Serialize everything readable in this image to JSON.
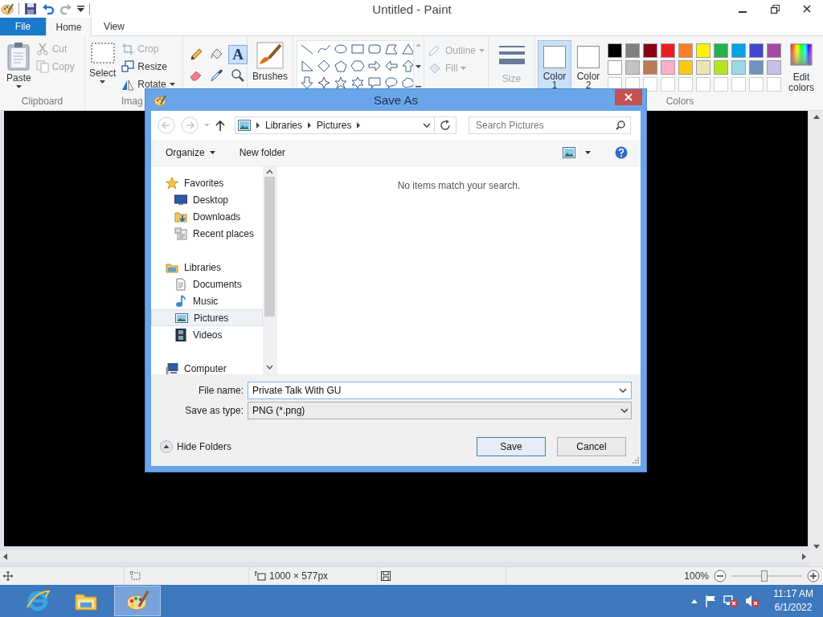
{
  "paint_window": {
    "title": "Untitled - Paint"
  },
  "ribbon": {
    "tabs": [
      {
        "label": "File",
        "kind": "file",
        "selected": false
      },
      {
        "label": "Home",
        "kind": "tab",
        "selected": true
      },
      {
        "label": "View",
        "kind": "tab",
        "selected": false
      }
    ],
    "clipboard": {
      "label": "Clipboard",
      "paste": "Paste",
      "cut": {
        "label": "Cut",
        "disabled": true
      },
      "copy": {
        "label": "Copy",
        "disabled": true
      }
    },
    "image": {
      "label": "Imag",
      "select": "Select",
      "crop": {
        "label": "Crop",
        "disabled": true
      },
      "resize": {
        "label": "Resize",
        "disabled": false
      },
      "rotate": {
        "label": "Rotate",
        "disabled": false
      }
    },
    "tools": [
      {
        "kind": "pencil",
        "selected": false
      },
      {
        "kind": "fill",
        "selected": false
      },
      {
        "kind": "text",
        "glyph": "A",
        "selected": true
      },
      {
        "kind": "eraser",
        "selected": false
      },
      {
        "kind": "picker",
        "selected": false
      },
      {
        "kind": "magnifier",
        "selected": false
      }
    ],
    "brushes": "Brushes",
    "shape_style": {
      "outline": {
        "label": "Outline",
        "disabled": true
      },
      "fill": {
        "label": "Fill",
        "disabled": true
      }
    },
    "size": {
      "label": "Size",
      "disabled": true
    },
    "colors": {
      "label": "Colors",
      "slots": [
        {
          "label": "Color",
          "number": "1",
          "color": "#ffffff",
          "selected": true
        },
        {
          "label": "Color",
          "number": "2",
          "color": "#ffffff",
          "selected": false
        }
      ],
      "palette": [
        {
          "color": "#000000"
        },
        {
          "color": "#7f7f7f"
        },
        {
          "color": "#880015"
        },
        {
          "color": "#ed1c24"
        },
        {
          "color": "#ff7f27"
        },
        {
          "color": "#fff200"
        },
        {
          "color": "#22b14c"
        },
        {
          "color": "#00a2e8"
        },
        {
          "color": "#3f48cc"
        },
        {
          "color": "#a349a4"
        },
        {
          "color": "#ffffff"
        },
        {
          "color": "#c3c3c3"
        },
        {
          "color": "#b97a57"
        },
        {
          "color": "#ffaec9"
        },
        {
          "color": "#ffc90e"
        },
        {
          "color": "#efe4b0"
        },
        {
          "color": "#b5e61d"
        },
        {
          "color": "#99d9ea"
        },
        {
          "color": "#7092be"
        },
        {
          "color": "#c8bfe7"
        },
        {
          "kind": "empty"
        },
        {
          "kind": "empty"
        },
        {
          "kind": "empty"
        },
        {
          "kind": "empty"
        },
        {
          "kind": "empty"
        },
        {
          "kind": "empty"
        },
        {
          "kind": "empty"
        },
        {
          "kind": "empty"
        },
        {
          "kind": "empty"
        },
        {
          "kind": "empty"
        }
      ],
      "edit": "Edit colors"
    }
  },
  "status_bar": {
    "dimensions": "1000 × 577px",
    "zoom": "100%",
    "zoom_slider": {
      "level": 0.47
    }
  },
  "taskbar": {
    "apps": [
      {
        "kind": "browser",
        "selected": false
      },
      {
        "kind": "explorer",
        "selected": false
      },
      {
        "kind": "paint",
        "selected": true
      }
    ],
    "time": "11:17 AM",
    "date": "6/1/2022"
  },
  "save_dialog": {
    "title": "Save As",
    "breadcrumb": [
      {
        "label": "Libraries"
      },
      {
        "label": "Pictures"
      }
    ],
    "search": {
      "placeholder": "Search Pictures"
    },
    "commands": {
      "organize": "Organize",
      "new_folder": "New folder"
    },
    "tree": [
      {
        "label": "Favorites",
        "kind": "favorites",
        "selected": false,
        "children": [
          {
            "label": "Desktop",
            "kind": "desktop",
            "selected": false
          },
          {
            "label": "Downloads",
            "kind": "downloads",
            "selected": false
          },
          {
            "label": "Recent places",
            "kind": "recent",
            "selected": false
          }
        ]
      },
      {
        "label": "Libraries",
        "kind": "libraries",
        "selected": false,
        "children": [
          {
            "label": "Documents",
            "kind": "documents",
            "selected": false
          },
          {
            "label": "Music",
            "kind": "music",
            "selected": false
          },
          {
            "label": "Pictures",
            "kind": "pictures",
            "selected": true
          },
          {
            "label": "Videos",
            "kind": "videos",
            "selected": false
          }
        ]
      },
      {
        "label": "Computer",
        "kind": "computer",
        "selected": false
      }
    ],
    "message": "No items match your search.",
    "file_name": {
      "label": "File name:",
      "value": "Private Talk With GU"
    },
    "save_type": {
      "label": "Save as type:",
      "value": "PNG (*.png)"
    },
    "hide_folders": "Hide Folders",
    "buttons": [
      {
        "label": "Save",
        "kind": "default"
      },
      {
        "label": "Cancel",
        "kind": "normal"
      }
    ]
  }
}
